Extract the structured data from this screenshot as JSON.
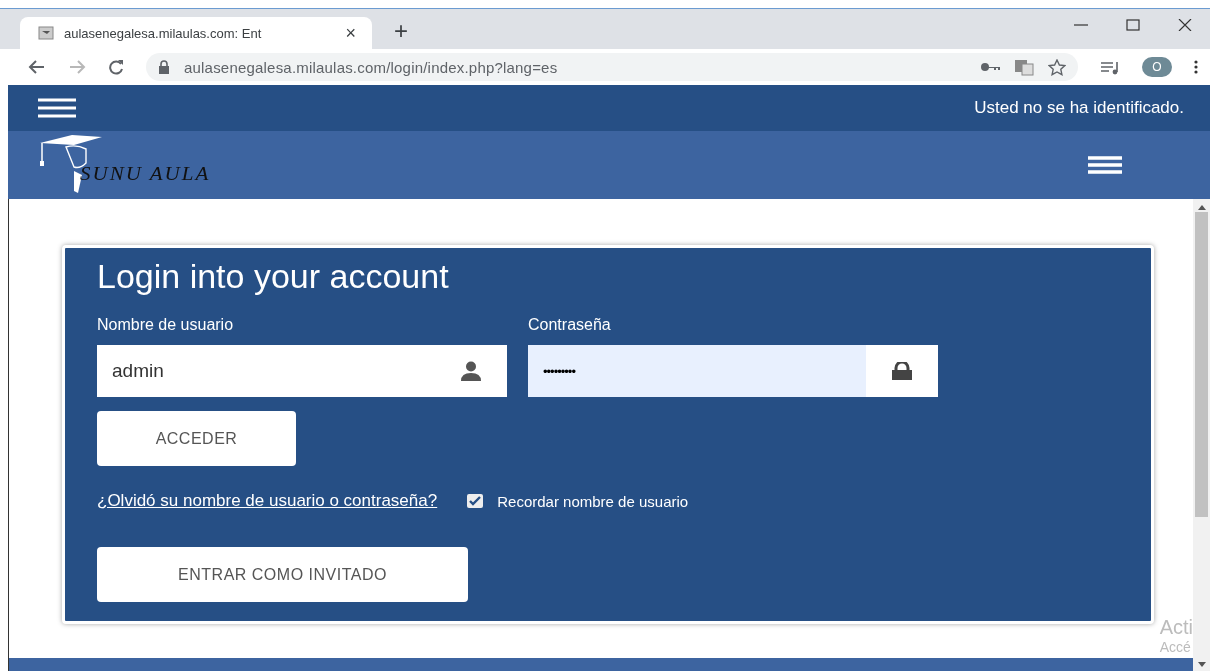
{
  "browser": {
    "tab_title": "aulasenegalesa.milaulas.com: Ent",
    "tab_close": "×",
    "new_tab": "+",
    "url": "aulasenegalesa.milaulas.com/login/index.php?lang=es",
    "profile_initial": "O"
  },
  "navbar": {
    "status": "Usted no se ha identificado."
  },
  "brand": {
    "name": "SUNU AULA"
  },
  "login": {
    "title": "Login into your account",
    "username": {
      "label": "Nombre de usuario",
      "value": "admin"
    },
    "password": {
      "label": "Contraseña",
      "value": "•••••••••"
    },
    "submit": "ACCEDER",
    "forgot_link": "¿Olvidó su nombre de usuario o contraseña?",
    "remember": {
      "label": "Recordar nombre de usuario",
      "checked": true
    },
    "guest_button": "ENTRAR COMO INVITADO"
  },
  "os_overlay": [
    "Acti",
    "Accé"
  ]
}
